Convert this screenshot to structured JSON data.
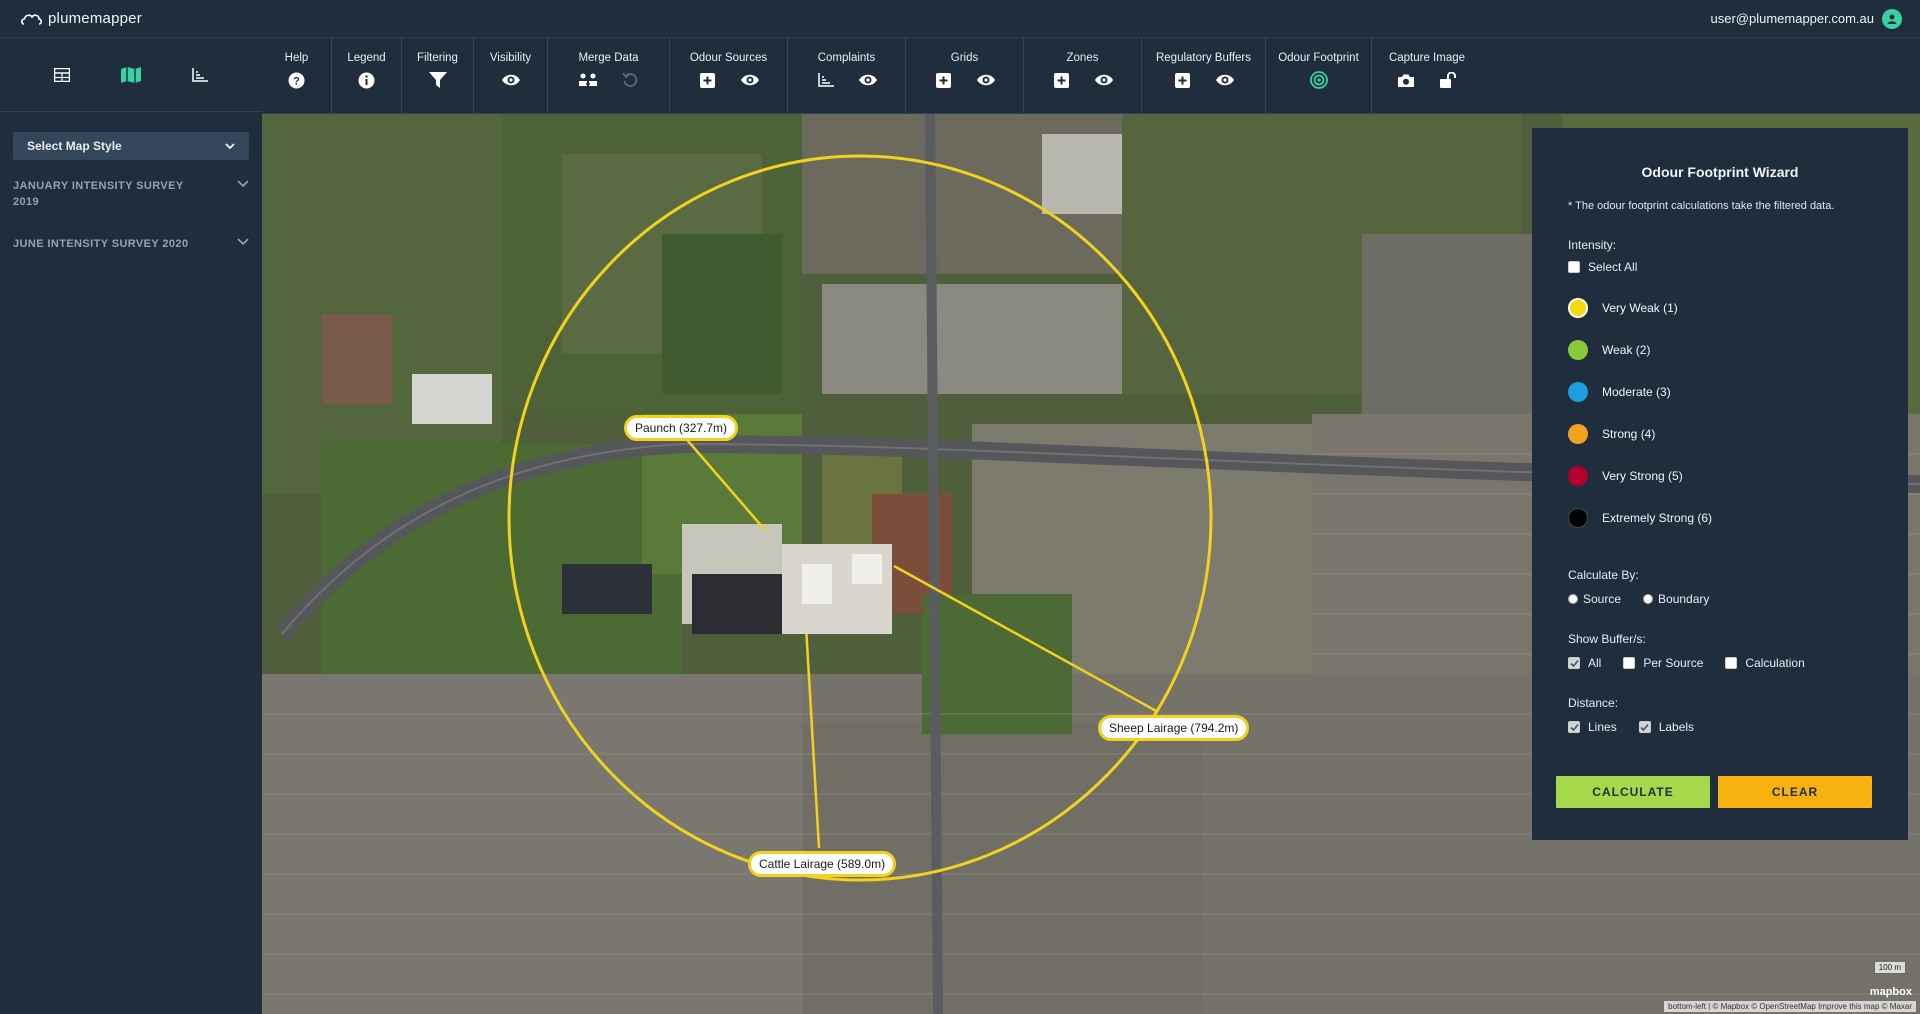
{
  "app": {
    "logo_text": "plumemapper",
    "user_email": "user@plumemapper.com.au"
  },
  "sidebar": {
    "tabs": [
      "table-icon",
      "map-icon",
      "chart-icon"
    ],
    "map_style_label": "Select Map Style",
    "surveys": [
      {
        "label": "JANUARY INTENSITY SURVEY 2019"
      },
      {
        "label": "JUNE INTENSITY SURVEY 2020"
      }
    ]
  },
  "toolbar": {
    "groups": [
      {
        "label": "Help"
      },
      {
        "label": "Legend"
      },
      {
        "label": "Filtering"
      },
      {
        "label": "Visibility"
      },
      {
        "label": "Merge Data"
      },
      {
        "label": "Odour Sources"
      },
      {
        "label": "Complaints"
      },
      {
        "label": "Grids"
      },
      {
        "label": "Zones"
      },
      {
        "label": "Regulatory Buffers"
      },
      {
        "label": "Odour Footprint"
      },
      {
        "label": "Capture Image"
      }
    ]
  },
  "map": {
    "labels": {
      "paunch": "Paunch (327.7m)",
      "sheep": "Sheep Lairage (794.2m)",
      "cattle": "Cattle Lairage (589.0m)"
    },
    "scale": "100 m",
    "attribution": "bottom-left | © Mapbox © OpenStreetMap Improve this map © Maxar",
    "mapbox": "mapbox",
    "accent": "#f2d21c"
  },
  "wizard": {
    "title": "Odour Footprint Wizard",
    "note": "* The odour footprint calculations take the filtered data.",
    "intensity_label": "Intensity:",
    "select_all": "Select All",
    "intensities": [
      {
        "label": "Very Weak (1)",
        "color": "#f5d90a"
      },
      {
        "label": "Weak (2)",
        "color": "#8ac83c"
      },
      {
        "label": "Moderate (3)",
        "color": "#1e9ee0"
      },
      {
        "label": "Strong (4)",
        "color": "#f3a21f"
      },
      {
        "label": "Very Strong (5)",
        "color": "#b3002d"
      },
      {
        "label": "Extremely Strong (6)",
        "color": "#000000"
      }
    ],
    "calculate_by_label": "Calculate By:",
    "calc_source": "Source",
    "calc_boundary": "Boundary",
    "show_buffers_label": "Show Buffer/s:",
    "buf_all": "All",
    "buf_per_source": "Per Source",
    "buf_calculation": "Calculation",
    "distance_label": "Distance:",
    "dist_lines": "Lines",
    "dist_labels": "Labels",
    "calculate_btn": "CALCULATE",
    "clear_btn": "CLEAR",
    "calculate_color": "#a6d94a",
    "clear_color": "#f7b210"
  }
}
